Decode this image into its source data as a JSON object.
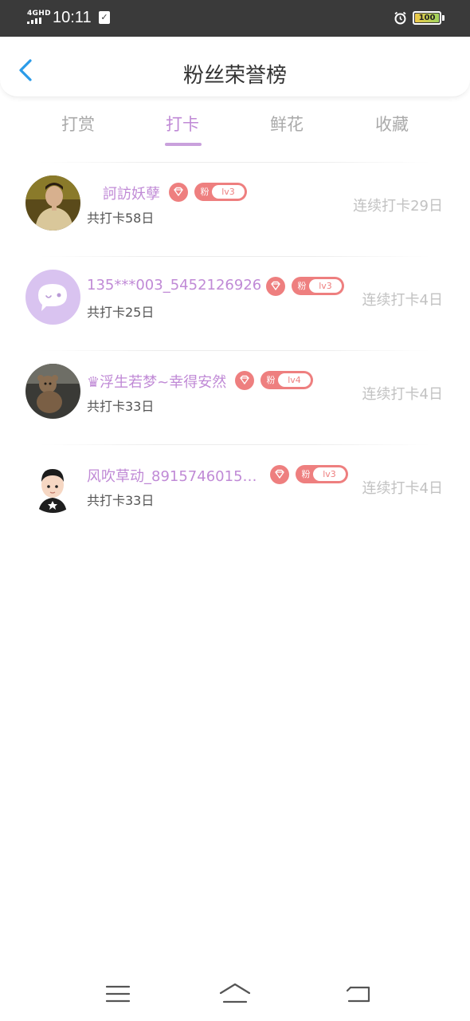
{
  "status_bar": {
    "network": "4GHD",
    "time": "10:11",
    "battery": "100"
  },
  "header": {
    "title": "粉丝荣誉榜"
  },
  "tabs": [
    {
      "label": "打赏",
      "active": false
    },
    {
      "label": "打卡",
      "active": true
    },
    {
      "label": "鲜花",
      "active": false
    },
    {
      "label": "收藏",
      "active": false
    }
  ],
  "fans": [
    {
      "name": "訶訪妖孽",
      "level": "lv3",
      "fan_tag": "粉",
      "total": "共打卡58日",
      "streak": "连续打卡29日"
    },
    {
      "name": "135***003_5452126926",
      "level": "lv3",
      "fan_tag": "粉",
      "total": "共打卡25日",
      "streak": "连续打卡4日"
    },
    {
      "name": "♛浮生若梦~幸得安然",
      "level": "lv4",
      "fan_tag": "粉",
      "total": "共打卡33日",
      "streak": "连续打卡4日"
    },
    {
      "name": "风吹草动_8915746015…",
      "level": "lv3",
      "fan_tag": "粉",
      "total": "共打卡33日",
      "streak": "连续打卡4日"
    }
  ],
  "colors": {
    "accent": "#c08ad6",
    "badge": "#ee7f7f",
    "back_arrow": "#2a9be8"
  },
  "icons": {
    "back": "chevron-left-icon",
    "diamond": "diamond-icon",
    "menu": "menu-icon",
    "home": "home-icon",
    "return": "return-icon"
  }
}
